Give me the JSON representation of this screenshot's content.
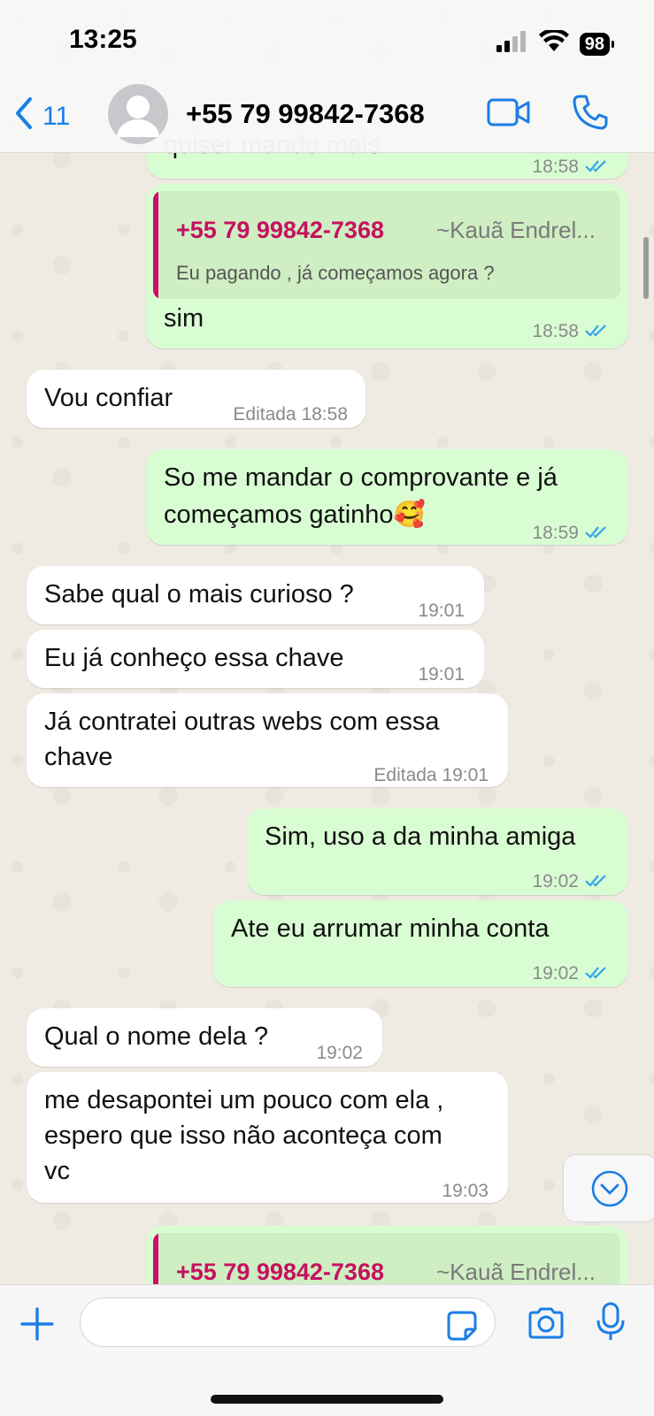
{
  "status_bar": {
    "time": "13:25",
    "battery": "98"
  },
  "header": {
    "back_count": "11",
    "contact_name": "+55 79 99842-7368"
  },
  "messages": [
    {
      "partial_text": "quiser mando mais",
      "time": "18:58"
    },
    {
      "quote_name": "+55 79 99842-7368",
      "quote_sender": "~Kauã Endrel...",
      "quote_text": "Eu pagando , já começamos agora ?",
      "text": "sim",
      "time": "18:58"
    },
    {
      "text": "Vou confiar",
      "time": "Editada 18:58"
    },
    {
      "text_line1": "So me mandar o comprovante e já",
      "text_line2": "começamos gatinho🥰",
      "time": "18:59"
    },
    {
      "text": "Sabe qual o mais curioso ?",
      "time": "19:01"
    },
    {
      "text": "Eu já conheço essa chave",
      "time": "19:01"
    },
    {
      "text_line1": "Já contratei outras webs com essa",
      "text_line2": "chave",
      "time": "Editada 19:01"
    },
    {
      "text": "Sim, uso a da minha amiga",
      "time": "19:02"
    },
    {
      "text": "Ate eu arrumar minha conta",
      "time": "19:02"
    },
    {
      "text": "Qual o nome dela ?",
      "time": "19:02"
    },
    {
      "text_line1": "me desapontei um pouco com ela ,",
      "text_line2": "espero que isso não aconteça com",
      "text_line3": "vc",
      "time": "19:03"
    },
    {
      "quote_name": "+55 79 99842-7368",
      "quote_sender": "~Kauã Endrel..."
    }
  ],
  "composer": {
    "placeholder": ""
  },
  "colors": {
    "outgoing": "#d9fdd3",
    "incoming": "#ffffff",
    "accent": "#1a7ee5",
    "quote_name": "#c5115f",
    "ticks": "#34a4e8"
  }
}
